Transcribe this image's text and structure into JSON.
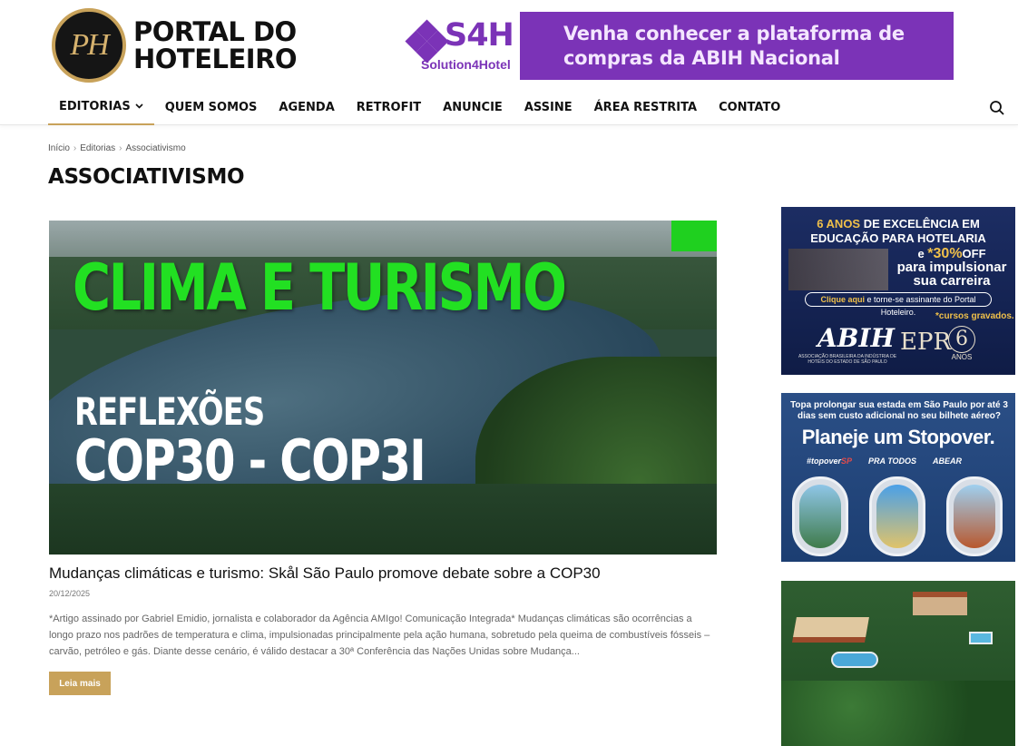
{
  "header": {
    "logo_monogram": "PH",
    "logo_line1": "PORTAL DO",
    "logo_line2": "HOTELEIRO",
    "banner": {
      "brand": "S4H",
      "brand_sub": "Solution4Hotel",
      "text_line1": "Venha conhecer a plataforma de",
      "text_line2": "compras da ABIH Nacional",
      "color": "#7b33b7"
    }
  },
  "nav": {
    "items": [
      {
        "label": "EDITORIAS"
      },
      {
        "label": "QUEM SOMOS"
      },
      {
        "label": "AGENDA"
      },
      {
        "label": "RETROFIT"
      },
      {
        "label": "ANUNCIE"
      },
      {
        "label": "ASSINE"
      },
      {
        "label": "ÁREA RESTRITA"
      },
      {
        "label": "CONTATO"
      }
    ],
    "active_underline_color": "#c8a25a"
  },
  "breadcrumb": [
    "Início",
    "Editorias",
    "Associativismo"
  ],
  "page": {
    "title": "ASSOCIATIVISMO"
  },
  "article": {
    "image_line1": "CLIMA E TURISMO",
    "image_line2": "REFLEXÕES",
    "image_line3": "COP30 - COP3I",
    "title": "Mudanças climáticas e turismo: Skål São Paulo promove debate sobre a COP30",
    "date": "20/12/2025",
    "excerpt": "*Artigo assinado por Gabriel Emidio, jornalista e colaborador da Agência AMIgo! Comunicação Integrada* Mudanças climáticas são ocorrências a longo prazo nos padrões de temperatura e clima, impulsionadas principalmente pela ação humana, sobretudo pela queima de combustíveis fósseis – carvão, petróleo e gás. Diante desse cenário, é válido destacar a 30ª Conferência das Nações Unidas sobre Mudança...",
    "read_more": "Leia mais",
    "accent": "#c8a25a"
  },
  "sidebar": {
    "ad1": {
      "line1_gold": "6 ANOS",
      "line1_rest": " DE EXCELÊNCIA EM",
      "line2": "EDUCAÇÃO PARA HOTELARIA",
      "pct_pre": "e ",
      "pct_big": "*30%",
      "pct_off": "OFF",
      "pct_l2": "para impulsionar",
      "pct_l3": "sua carreira",
      "cta_b": "Clique aqui",
      "cta_rest": " e torne-se assinante do Portal Hoteleiro.",
      "note": "*cursos gravados.",
      "abih": "ABIH",
      "abih_sub": "ASSOCIAÇÃO BRASILEIRA DA INDÚSTRIA DE HOTÉIS DO ESTADO DE SÃO PAULO",
      "epr": "EPR",
      "six": "6",
      "anos": "ANOS"
    },
    "ad2": {
      "question": "Topa prolongar sua estada em São Paulo por até 3 dias sem custo adicional no seu bilhete aéreo?",
      "headline": "Planeje um Stopover.",
      "tag1_a": "#topover",
      "tag1_b": "SP",
      "tag2": "PRA TODOS",
      "tag3": "ABEAR"
    }
  }
}
